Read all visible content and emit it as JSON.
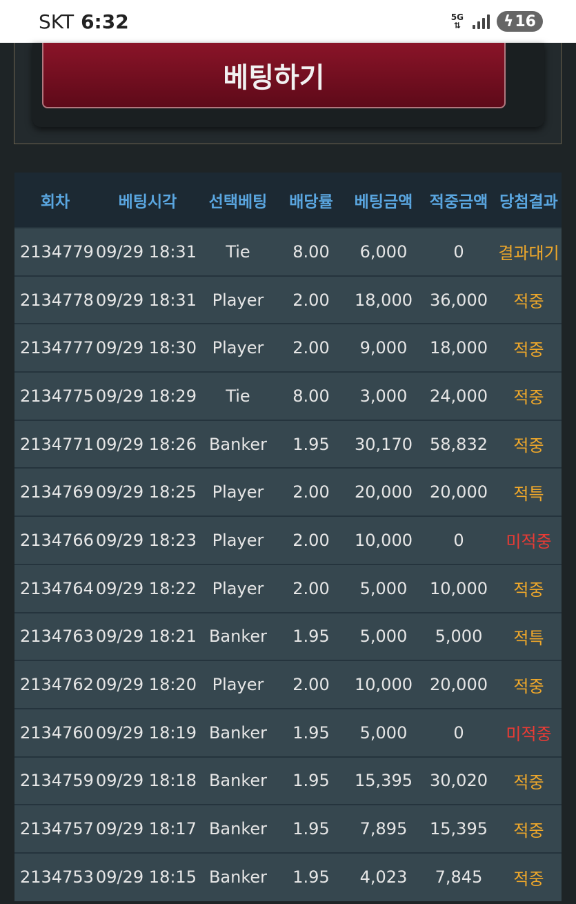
{
  "status_bar": {
    "carrier": "SKT",
    "time": "6:32",
    "network": "5G",
    "battery": "16"
  },
  "bet_button_label": "베팅하기",
  "table": {
    "headers": [
      "회차",
      "베팅시각",
      "선택베팅",
      "배당률",
      "베팅금액",
      "적중금액",
      "당첨결과"
    ],
    "rows": [
      {
        "round": "2134779",
        "time": "09/29 18:31",
        "pick": "Tie",
        "odds": "8.00",
        "bet": "6,000",
        "payout": "0",
        "result": "결과대기",
        "status": "wait"
      },
      {
        "round": "2134778",
        "time": "09/29 18:31",
        "pick": "Player",
        "odds": "2.00",
        "bet": "18,000",
        "payout": "36,000",
        "result": "적중",
        "status": "win"
      },
      {
        "round": "2134777",
        "time": "09/29 18:30",
        "pick": "Player",
        "odds": "2.00",
        "bet": "9,000",
        "payout": "18,000",
        "result": "적중",
        "status": "win"
      },
      {
        "round": "2134775",
        "time": "09/29 18:29",
        "pick": "Tie",
        "odds": "8.00",
        "bet": "3,000",
        "payout": "24,000",
        "result": "적중",
        "status": "win"
      },
      {
        "round": "2134771",
        "time": "09/29 18:26",
        "pick": "Banker",
        "odds": "1.95",
        "bet": "30,170",
        "payout": "58,832",
        "result": "적중",
        "status": "win"
      },
      {
        "round": "2134769",
        "time": "09/29 18:25",
        "pick": "Player",
        "odds": "2.00",
        "bet": "20,000",
        "payout": "20,000",
        "result": "적특",
        "status": "win"
      },
      {
        "round": "2134766",
        "time": "09/29 18:23",
        "pick": "Player",
        "odds": "2.00",
        "bet": "10,000",
        "payout": "0",
        "result": "미적중",
        "status": "lose"
      },
      {
        "round": "2134764",
        "time": "09/29 18:22",
        "pick": "Player",
        "odds": "2.00",
        "bet": "5,000",
        "payout": "10,000",
        "result": "적중",
        "status": "win"
      },
      {
        "round": "2134763",
        "time": "09/29 18:21",
        "pick": "Banker",
        "odds": "1.95",
        "bet": "5,000",
        "payout": "5,000",
        "result": "적특",
        "status": "win"
      },
      {
        "round": "2134762",
        "time": "09/29 18:20",
        "pick": "Player",
        "odds": "2.00",
        "bet": "10,000",
        "payout": "20,000",
        "result": "적중",
        "status": "win"
      },
      {
        "round": "2134760",
        "time": "09/29 18:19",
        "pick": "Banker",
        "odds": "1.95",
        "bet": "5,000",
        "payout": "0",
        "result": "미적중",
        "status": "lose"
      },
      {
        "round": "2134759",
        "time": "09/29 18:18",
        "pick": "Banker",
        "odds": "1.95",
        "bet": "15,395",
        "payout": "30,020",
        "result": "적중",
        "status": "win"
      },
      {
        "round": "2134757",
        "time": "09/29 18:17",
        "pick": "Banker",
        "odds": "1.95",
        "bet": "7,895",
        "payout": "15,395",
        "result": "적중",
        "status": "win"
      },
      {
        "round": "2134753",
        "time": "09/29 18:15",
        "pick": "Banker",
        "odds": "1.95",
        "bet": "4,023",
        "payout": "7,845",
        "result": "적중",
        "status": "win"
      }
    ]
  },
  "colors": {
    "header_text": "#5aa6e0",
    "result_win": "#f0a82a",
    "result_lose": "#ea3b35",
    "button": "#7a1024"
  }
}
